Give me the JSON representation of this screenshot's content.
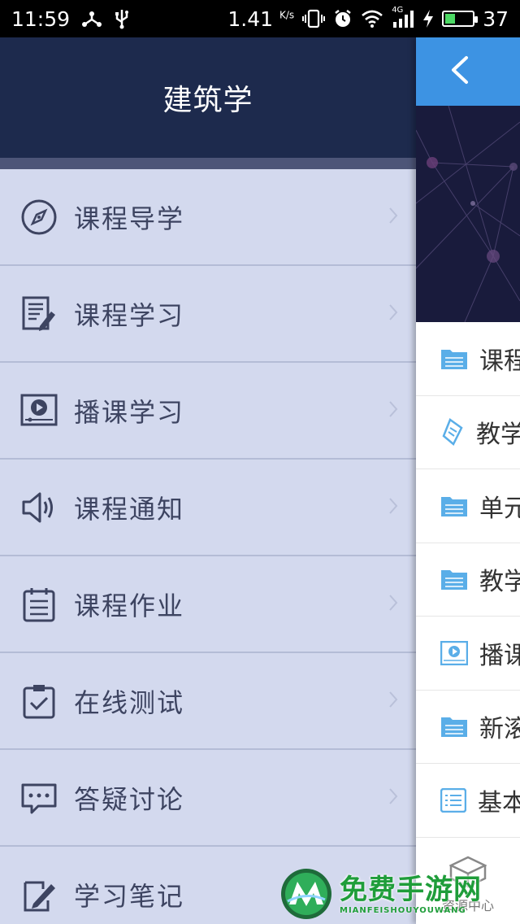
{
  "status_bar": {
    "time": "11:59",
    "speed": "1.41",
    "speed_unit": "K/s",
    "network": "4G",
    "battery": "37",
    "battery_level": 0.37
  },
  "drawer": {
    "title": "建筑学",
    "items": [
      {
        "label": "课程导学",
        "icon": "compass-icon"
      },
      {
        "label": "课程学习",
        "icon": "document-edit-icon"
      },
      {
        "label": "播课学习",
        "icon": "video-play-icon"
      },
      {
        "label": "课程通知",
        "icon": "speaker-icon"
      },
      {
        "label": "课程作业",
        "icon": "clipboard-list-icon"
      },
      {
        "label": "在线测试",
        "icon": "clipboard-check-icon"
      },
      {
        "label": "答疑讨论",
        "icon": "chat-bubble-icon"
      },
      {
        "label": "学习笔记",
        "icon": "note-pencil-icon"
      }
    ]
  },
  "content": {
    "back_icon": "chevron-left-icon",
    "list": [
      {
        "label": "课程",
        "icon": "folder-icon"
      },
      {
        "label": "教学",
        "icon": "scroll-icon"
      },
      {
        "label": "单元",
        "icon": "folder-icon"
      },
      {
        "label": "教学",
        "icon": "folder-icon"
      },
      {
        "label": "播课",
        "icon": "video-play-icon"
      },
      {
        "label": "新滚",
        "icon": "folder-icon"
      },
      {
        "label": "基本",
        "icon": "list-icon"
      }
    ],
    "resource_label": "资源中心"
  },
  "watermark": {
    "title": "免费手游网",
    "subtitle": "MIANFEISHOUYOUWANG"
  },
  "colors": {
    "drawer_header": "#1d2a4d",
    "drawer_bg": "#d3d9ee",
    "accent_blue": "#3d93e3"
  }
}
